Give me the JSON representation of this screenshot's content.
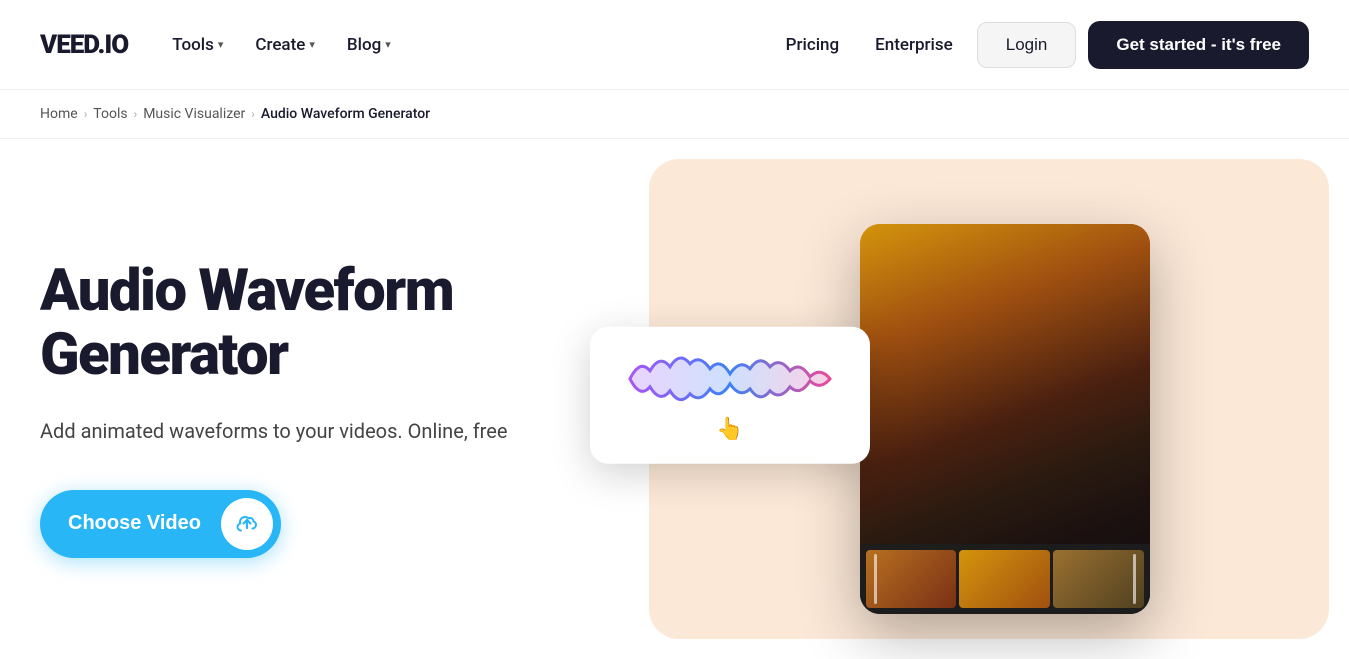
{
  "logo": "VEED.IO",
  "nav": {
    "items_left": [
      {
        "label": "Tools",
        "has_dropdown": true
      },
      {
        "label": "Create",
        "has_dropdown": true
      },
      {
        "label": "Blog",
        "has_dropdown": true
      }
    ],
    "items_right": [
      {
        "label": "Pricing"
      },
      {
        "label": "Enterprise"
      }
    ],
    "login_label": "Login",
    "cta_label": "Get started - it's free"
  },
  "breadcrumb": {
    "items": [
      {
        "label": "Home"
      },
      {
        "label": "Tools"
      },
      {
        "label": "Music Visualizer"
      },
      {
        "label": "Audio Waveform Generator",
        "current": true
      }
    ]
  },
  "hero": {
    "title": "Audio Waveform Generator",
    "description": "Add animated waveforms to your videos. Online, free",
    "cta_label": "Choose Video",
    "upload_icon": "↑"
  },
  "colors": {
    "logo_color": "#1a1a2e",
    "cta_bg": "#1a1a2e",
    "cta_text": "#ffffff",
    "choose_btn_bg": "#29b6f6",
    "blob_bg": "#fce4d0"
  }
}
